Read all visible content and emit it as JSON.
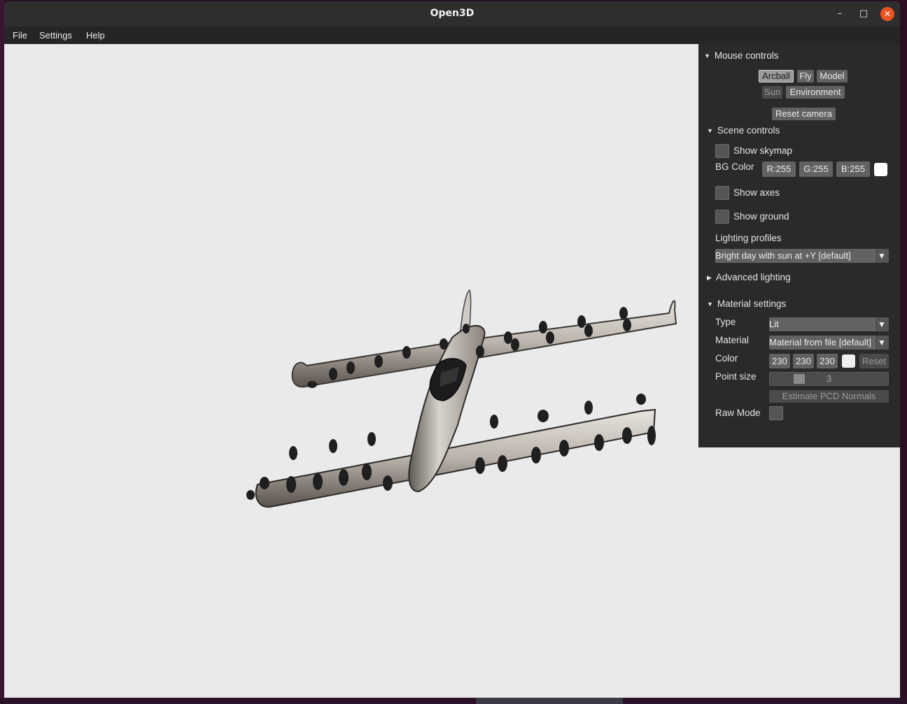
{
  "window": {
    "title": "Open3D",
    "minimize_glyph": "–",
    "maximize_glyph": "□",
    "close_glyph": "✕"
  },
  "menubar": {
    "items": [
      "File",
      "Settings",
      "Help"
    ]
  },
  "panel": {
    "mouse_controls": {
      "header": "Mouse controls",
      "buttons": [
        "Arcball",
        "Fly",
        "Model",
        "Sun",
        "Environment"
      ],
      "active": "Arcball",
      "reset_label": "Reset camera"
    },
    "scene_controls": {
      "header": "Scene controls",
      "show_skymap": "Show skymap",
      "bg_color_label": "BG Color",
      "bg_r": "R:255",
      "bg_g": "G:255",
      "bg_b": "B:255",
      "bg_swatch": "#ffffff",
      "show_axes": "Show axes",
      "show_ground": "Show ground",
      "lighting_profiles_label": "Lighting profiles",
      "lighting_profile_value": "Bright day with sun at +Y [default]"
    },
    "advanced_lighting": {
      "header": "Advanced lighting"
    },
    "material_settings": {
      "header": "Material settings",
      "type_label": "Type",
      "type_value": "Lit",
      "material_label": "Material",
      "material_value": "Material from file [default]",
      "color_label": "Color",
      "color_r": "230",
      "color_g": "230",
      "color_b": "230",
      "color_swatch": "#e6e6e6",
      "reset_label": "Reset",
      "point_size_label": "Point size",
      "point_size_value": "3",
      "estimate_label": "Estimate PCD Normals",
      "raw_mode_label": "Raw Mode"
    }
  },
  "colors": {
    "viewport_bg": "#eaeaea",
    "panel_bg": "#2a2a2a",
    "close_button": "#e95420"
  }
}
